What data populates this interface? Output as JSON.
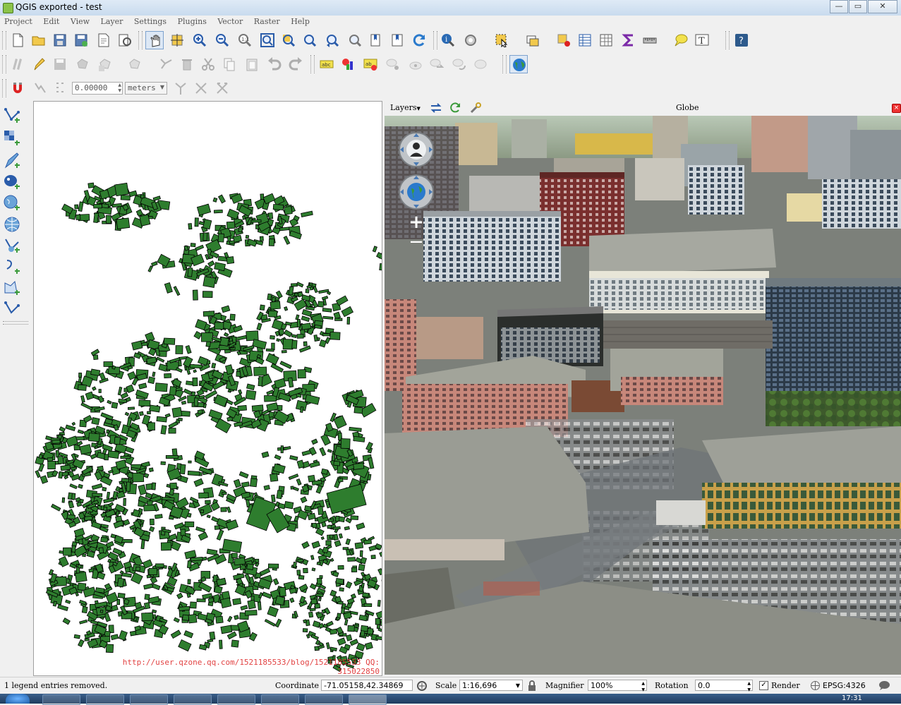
{
  "window": {
    "title": "QGIS exported - test",
    "controls": {
      "minimize": "—",
      "maximize": "▭",
      "close": "✕"
    }
  },
  "menubar": [
    "Project",
    "Edit",
    "View",
    "Layer",
    "Settings",
    "Plugins",
    "Vector",
    "Raster",
    "Help"
  ],
  "snapping_toolbar": {
    "tolerance_value": "0.00000",
    "units_value": "meters"
  },
  "globe_panel": {
    "layers_label": "Layers",
    "title": "Globe",
    "zoom_in": "+",
    "zoom_out": "—"
  },
  "map": {
    "watermark_line1": "http://user.qzone.qq.com/1521185533/blog/1521185533 QQ:",
    "watermark_line2": "315022850",
    "feature_color": "#2e7d2e"
  },
  "statusbar": {
    "message": "1 legend entries removed.",
    "coordinate_label": "Coordinate",
    "coordinate_value": "-71.05158,42.34869",
    "scale_label": "Scale",
    "scale_value": "1:16,696",
    "magnifier_label": "Magnifier",
    "magnifier_value": "100%",
    "rotation_label": "Rotation",
    "rotation_value": "0.0",
    "render_label": "Render",
    "crs_label": "EPSG:4326"
  },
  "taskbar": {
    "clock": "17:31"
  },
  "icons": {
    "main_toolbar": [
      "new-project-icon",
      "open-project-icon",
      "save-project-icon",
      "save-as-icon",
      "print-composer-icon",
      "composer-manager-icon",
      "pan-icon",
      "pan-to-selection-icon",
      "zoom-in-icon",
      "zoom-out-icon",
      "zoom-actual-icon",
      "zoom-full-icon",
      "zoom-selection-icon",
      "zoom-layer-icon",
      "zoom-last-icon",
      "zoom-next-icon",
      "new-bookmark-icon",
      "show-bookmarks-icon",
      "refresh-icon",
      "identify-icon",
      "measure-tool-icon",
      "select-features-icon",
      "select-by-expression-icon",
      "deselect-icon",
      "attribute-table-icon",
      "field-calculator-icon",
      "statistics-icon",
      "measure-line-icon",
      "map-tips-icon",
      "text-annotation-icon",
      "help-icon"
    ],
    "digitize_toolbar": [
      "edits-icon",
      "toggle-editing-icon",
      "save-edits-icon",
      "add-feature-icon",
      "move-feature-icon",
      "node-tool-icon",
      "delete-selected-icon",
      "cut-features-icon",
      "copy-features-icon",
      "paste-features-icon",
      "undo-icon",
      "redo-icon",
      "label-icon",
      "layer-diagram-icon",
      "label-highlight-icon",
      "pin-labels-icon",
      "show-hide-labels-icon",
      "move-label-icon",
      "rotate-label-icon",
      "change-label-icon",
      "globe-icon"
    ],
    "left_toolbar": [
      "add-vector-layer-icon",
      "add-raster-layer-icon",
      "add-delimited-text-icon",
      "add-postgis-icon",
      "add-spatialite-icon",
      "add-wms-icon",
      "add-wcs-icon",
      "add-wfs-icon",
      "new-shapefile-icon",
      "add-virtual-layer-icon"
    ]
  }
}
